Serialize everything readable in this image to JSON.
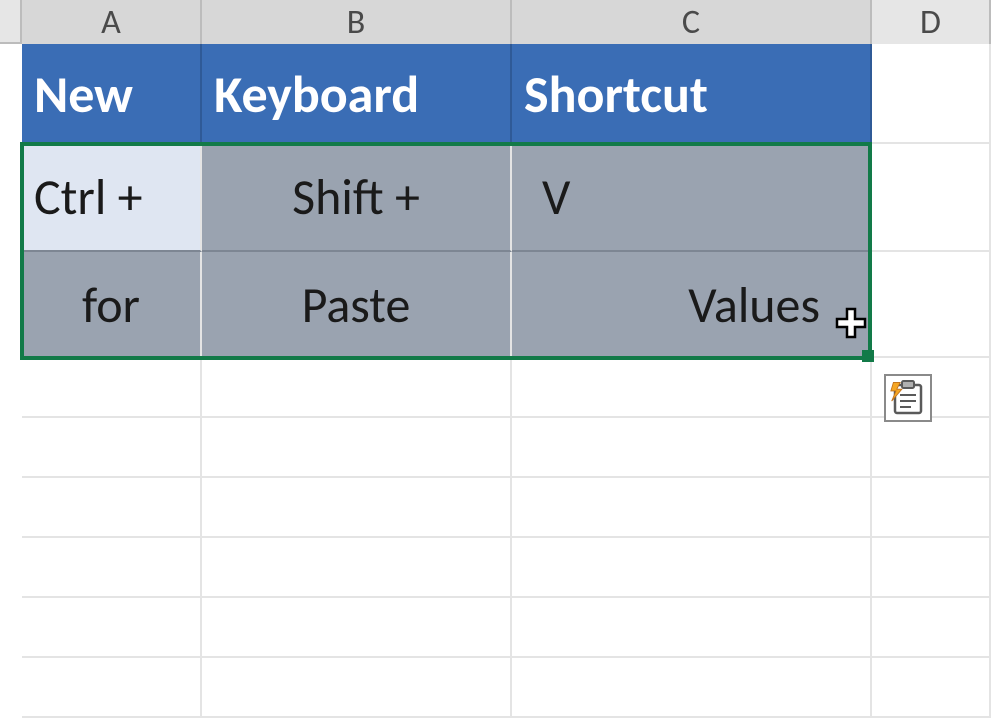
{
  "columns": [
    "A",
    "B",
    "C",
    "D"
  ],
  "cells": {
    "A1": "New",
    "B1": "Keyboard",
    "C1": "Shortcut",
    "A2": "Ctrl +",
    "B2": "Shift +",
    "C2": "V",
    "A3": "for",
    "B3": "Paste",
    "C3": "Values"
  },
  "icons": {
    "cursor": "cell-select-cross-icon",
    "paste_options": "paste-options-icon"
  },
  "selection": {
    "range": "A2:C3",
    "active_cell": "A2"
  }
}
